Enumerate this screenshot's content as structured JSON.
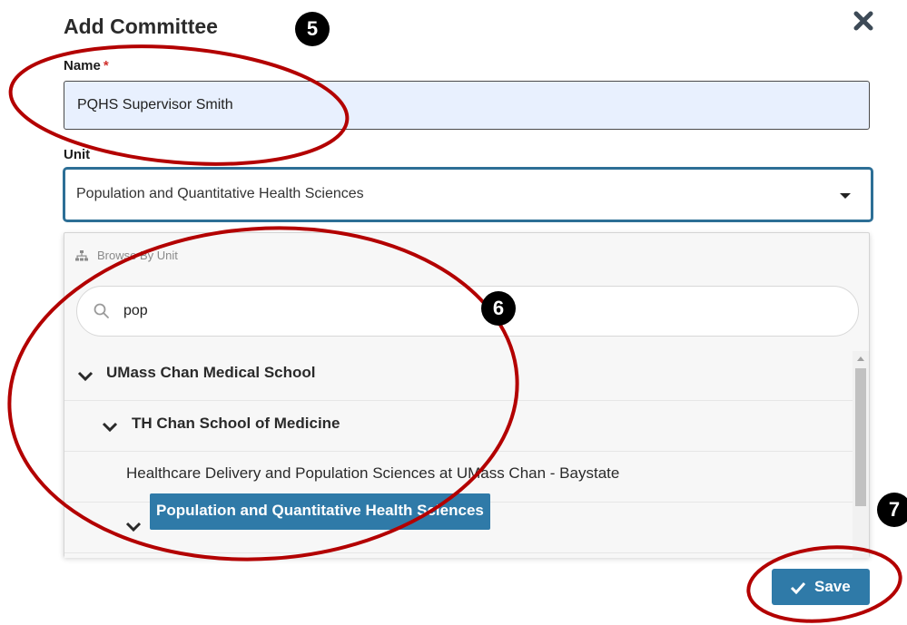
{
  "dialog": {
    "title": "Add Committee",
    "close_icon": "close-x-icon"
  },
  "name_field": {
    "label": "Name",
    "required_marker": "*",
    "value": "PQHS Supervisor Smith"
  },
  "unit_field": {
    "label": "Unit",
    "selected_value": "Population and Quantitative Health Sciences"
  },
  "dropdown": {
    "browse_label": "Browse By Unit",
    "search_value": "pop",
    "tree": [
      {
        "label": "UMass Chan Medical School",
        "expanded": true,
        "level": 0
      },
      {
        "label": "TH Chan School of Medicine",
        "expanded": true,
        "level": 1
      },
      {
        "label": "Healthcare Delivery and Population Sciences at UMass Chan - Baystate",
        "expanded": false,
        "level": 2
      },
      {
        "label": "Population and Quantitative Health Sciences",
        "expanded": true,
        "level": 2,
        "selected": true
      }
    ]
  },
  "actions": {
    "save_label": "Save"
  },
  "annotations": {
    "markers": [
      "5",
      "6",
      "7"
    ],
    "circle_color": "#b30000"
  },
  "colors": {
    "accent": "#2f7aa8",
    "input_bg": "#e8f0fe",
    "required": "#d0312d"
  }
}
